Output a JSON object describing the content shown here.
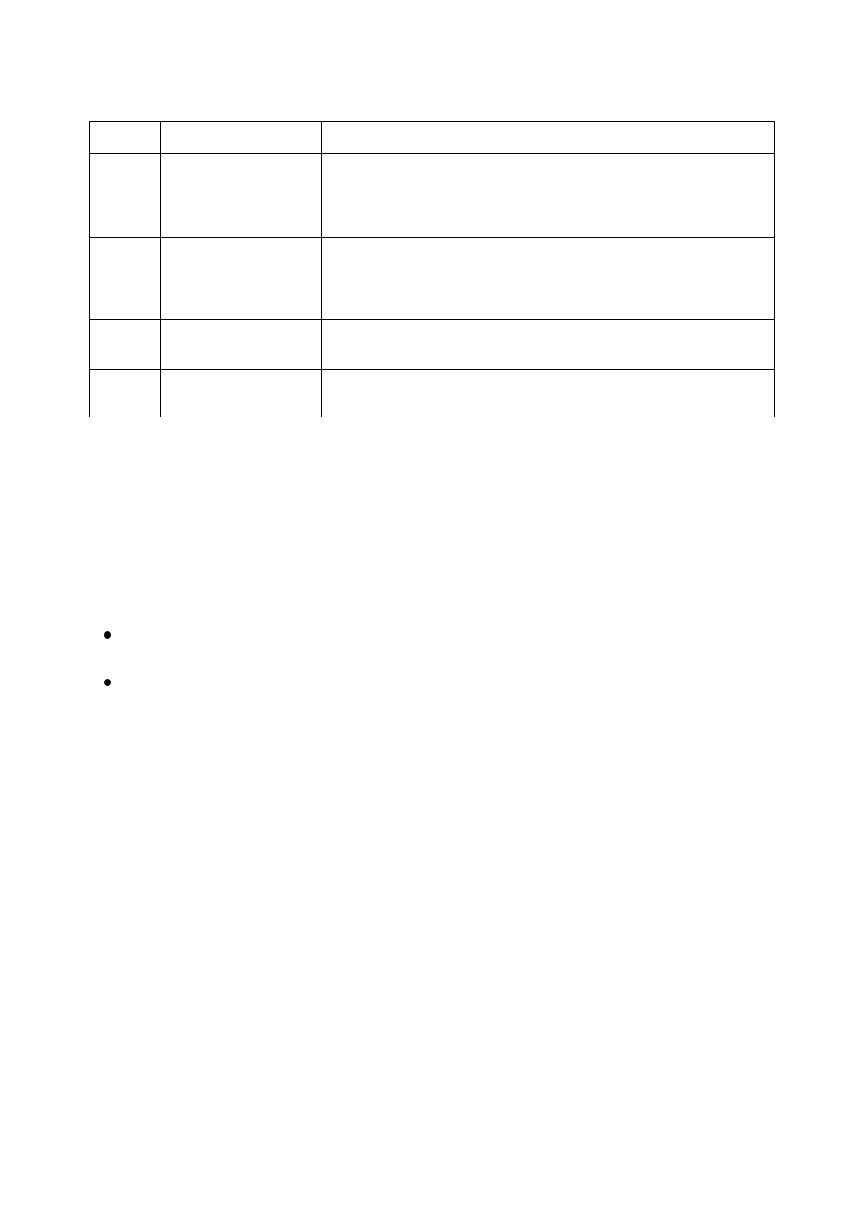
{
  "table": {
    "headers": [
      "",
      "",
      ""
    ],
    "rows": [
      [
        "",
        "",
        ""
      ],
      [
        "",
        "",
        ""
      ],
      [
        "",
        "",
        ""
      ],
      [
        "",
        "",
        ""
      ]
    ]
  },
  "bullets": [
    "",
    ""
  ]
}
